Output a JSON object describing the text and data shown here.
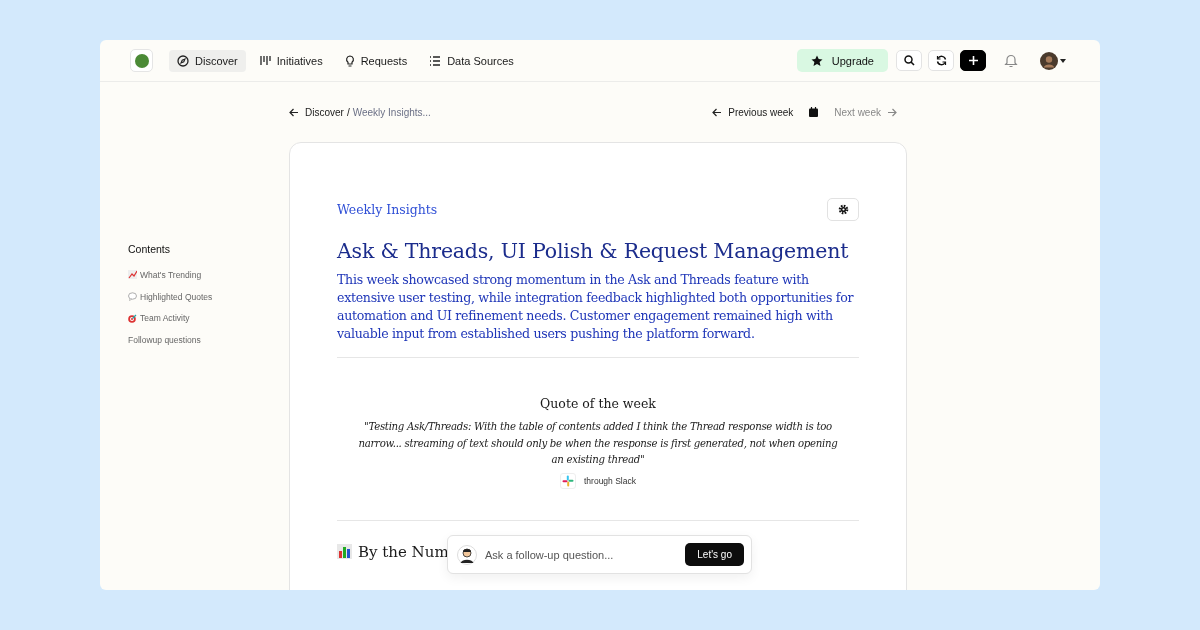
{
  "nav": {
    "items": [
      {
        "label": "Discover",
        "selected": true
      },
      {
        "label": "Initiatives",
        "selected": false
      },
      {
        "label": "Requests",
        "selected": false
      },
      {
        "label": "Data Sources",
        "selected": false
      }
    ],
    "upgrade": "Upgrade"
  },
  "breadcrumb": {
    "parent": "Discover",
    "separator": "/",
    "current": "Weekly Insights..."
  },
  "week_nav": {
    "previous": "Previous week",
    "next": "Next week",
    "next_disabled": true
  },
  "contents": {
    "title": "Contents",
    "items": [
      {
        "label": "What's Trending"
      },
      {
        "label": "Highlighted Quotes"
      },
      {
        "label": "Team Activity"
      },
      {
        "label": "Followup questions"
      }
    ]
  },
  "article": {
    "eyebrow": "Weekly Insights",
    "title": "Ask & Threads, UI Polish & Request Management",
    "summary": "This week showcased strong momentum in the Ask and Threads feature with extensive user testing, while integration feedback highlighted both opportunities for automation and UI refinement needs. Customer engagement remained high with valuable input from established users pushing the platform forward.",
    "quote": {
      "heading": "Quote of the week",
      "text": "\"Testing Ask/Threads: With the table of contents added I think the Thread response width is too narrow... streaming of text should only be when the response is first generated, not when opening an existing thread\"",
      "source": "through Slack"
    },
    "section_heading": "By the Num"
  },
  "ask": {
    "placeholder": "Ask a follow-up question...",
    "button": "Let's go"
  }
}
